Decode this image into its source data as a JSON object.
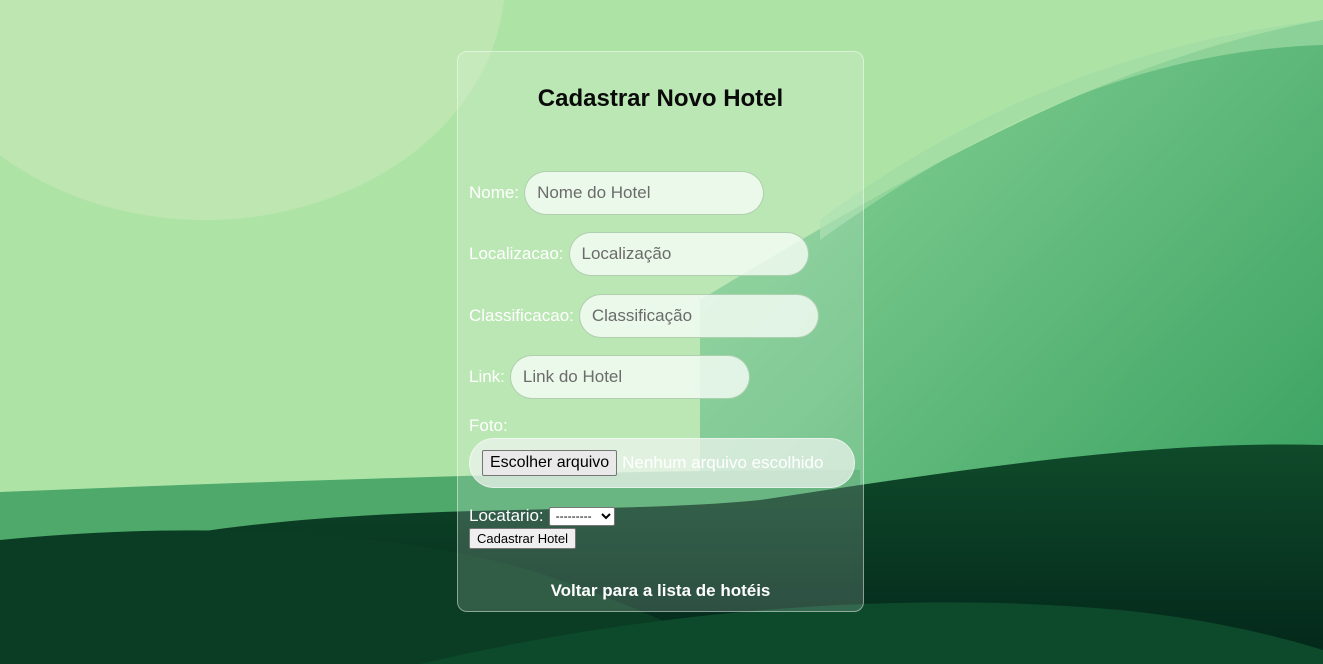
{
  "form": {
    "title": "Cadastrar Novo Hotel",
    "fields": {
      "nome": {
        "label": "Nome:",
        "placeholder": "Nome do Hotel",
        "value": ""
      },
      "localizacao": {
        "label": "Localizacao:",
        "placeholder": "Localização",
        "value": ""
      },
      "classificacao": {
        "label": "Classificacao:",
        "placeholder": "Classificação",
        "value": ""
      },
      "link": {
        "label": "Link:",
        "placeholder": "Link do Hotel",
        "value": ""
      }
    },
    "foto": {
      "label": "Foto:",
      "button_label": "Escolher arquivo",
      "status": "Nenhum arquivo escolhido"
    },
    "locatario": {
      "label": "Locatario:",
      "selected": "---------"
    },
    "submit_label": "Cadastrar Hotel",
    "back_link": "Voltar para a lista de hotéis"
  },
  "colors": {
    "background_light": "#b8e6b0",
    "background_mid": "#6cbf7e",
    "background_dark": "#05301c",
    "text_white": "#ffffff",
    "title": "#0a0a0a"
  }
}
